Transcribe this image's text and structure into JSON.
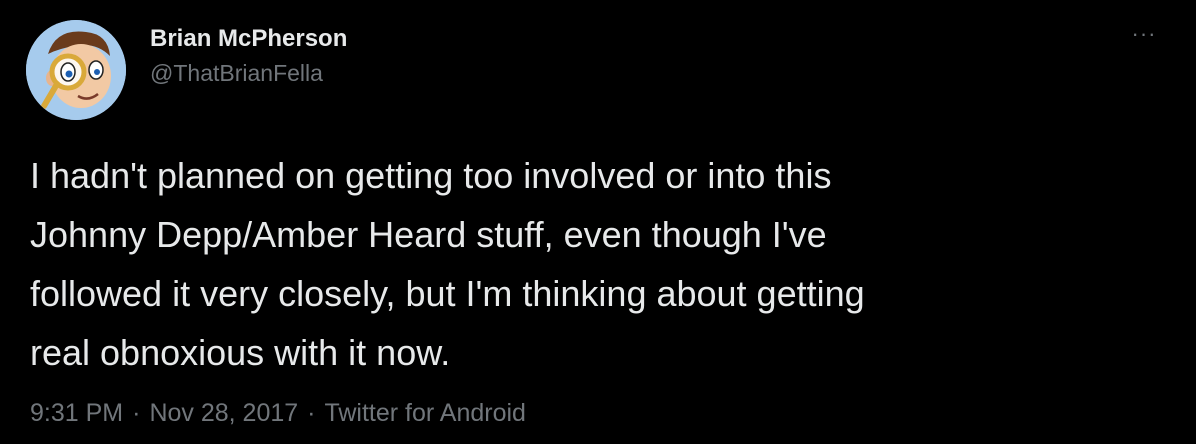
{
  "user": {
    "display_name": "Brian McPherson",
    "handle": "@ThatBrianFella",
    "avatar_icon": "cartoon-magnifying-glass-avatar"
  },
  "more_label": "···",
  "tweet": {
    "text": "I hadn't planned on getting too involved or into this\nJohnny Depp/Amber Heard stuff, even though I've\nfollowed it very closely, but I'm thinking about getting\nreal obnoxious with it now."
  },
  "meta": {
    "time": "9:31 PM",
    "separator": "·",
    "date": "Nov 28, 2017",
    "source": "Twitter for Android"
  },
  "colors": {
    "background": "#000000",
    "primary_text": "#e7e9ea",
    "secondary_text": "#71767b"
  }
}
